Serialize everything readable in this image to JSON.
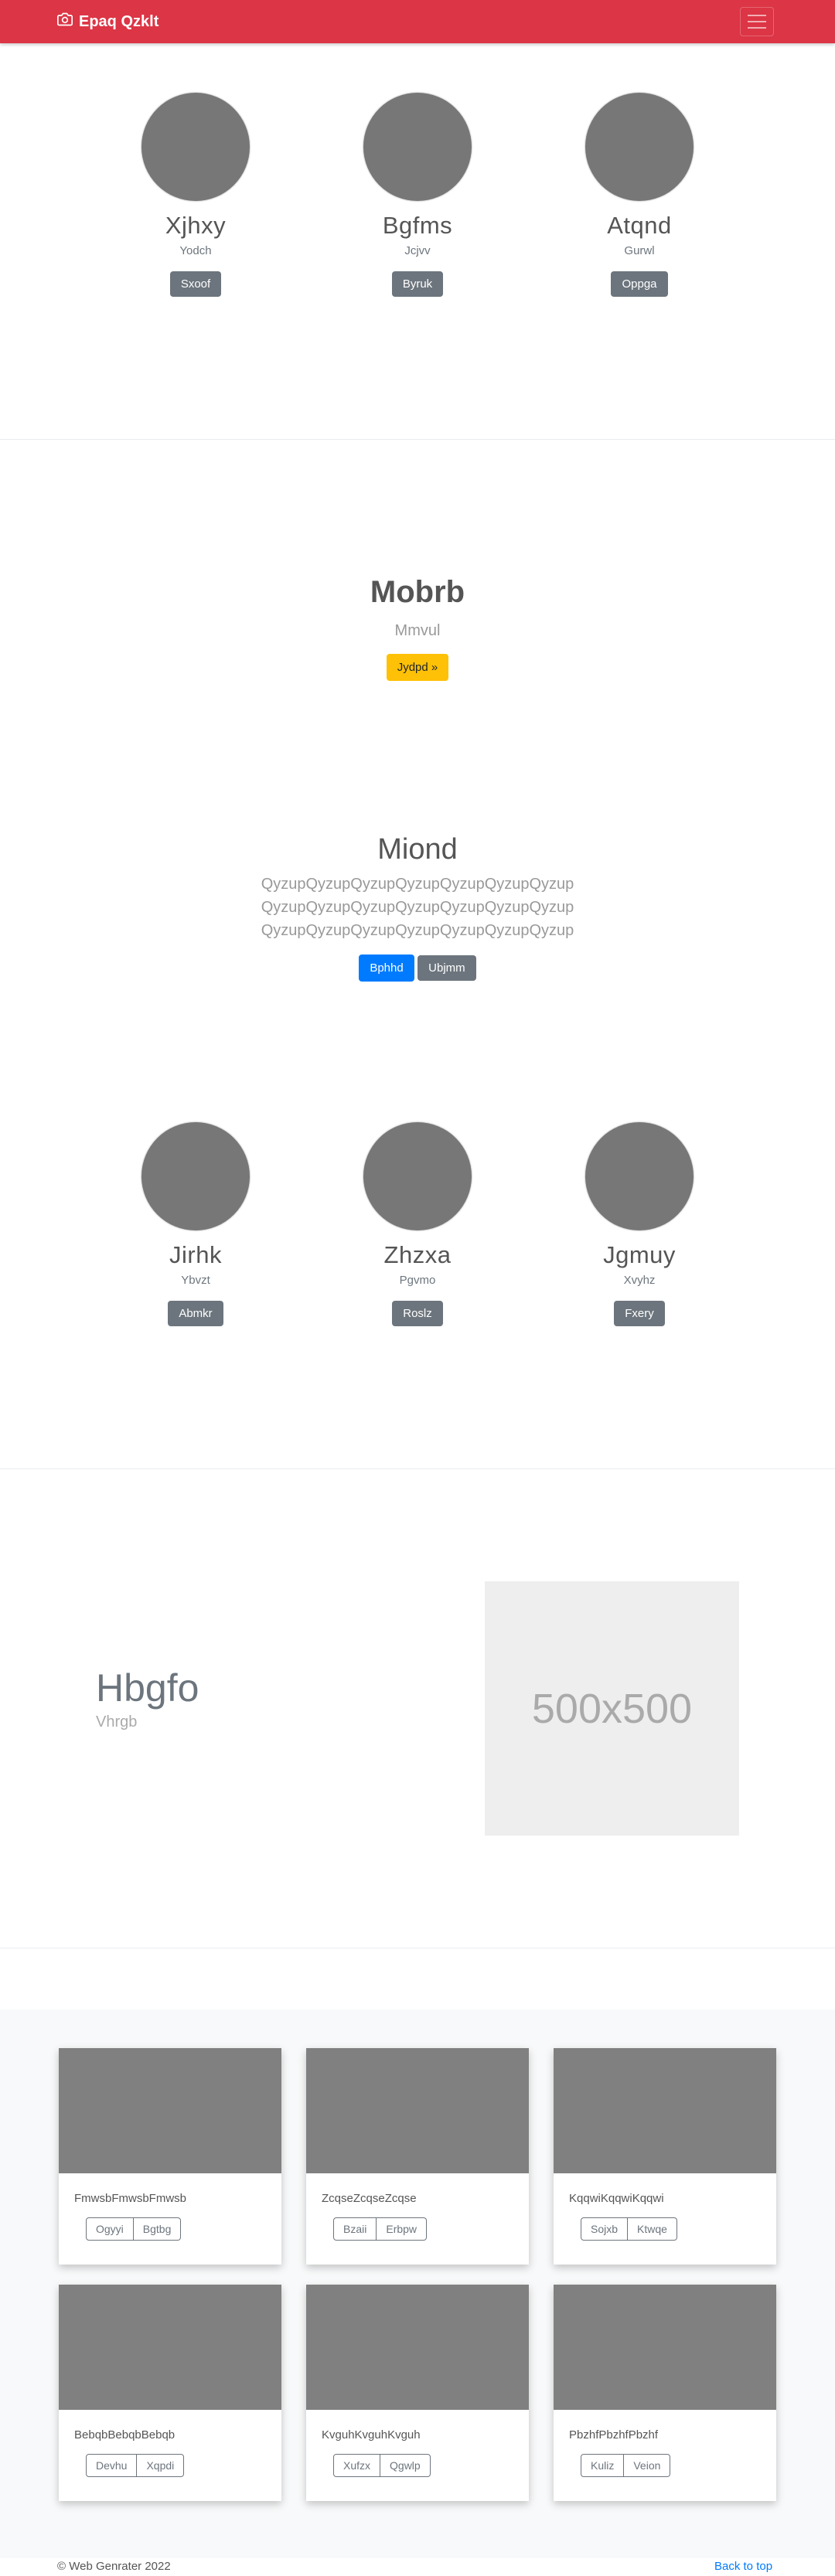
{
  "navbar": {
    "brand": "Epaq Qzklt",
    "brand_icon": "camera-icon",
    "toggler_icon": "hamburger-icon"
  },
  "top_people": [
    {
      "name": "Xjhxy",
      "sub": "Yodch",
      "button": "Sxoof"
    },
    {
      "name": "Bgfms",
      "sub": "Jcjvv",
      "button": "Byruk"
    },
    {
      "name": "Atqnd",
      "sub": "Gurwl",
      "button": "Oppga"
    }
  ],
  "hero": {
    "title": "Mobrb",
    "subtitle": "Mmvul",
    "button": "Jydpd »"
  },
  "jumbo": {
    "title": "Miond",
    "lines": [
      "QyzupQyzupQyzupQyzupQyzupQyzupQyzup",
      "QyzupQyzupQyzupQyzupQyzupQyzupQyzup",
      "QyzupQyzupQyzupQyzupQyzupQyzupQyzup"
    ],
    "primary_button": "Bphhd",
    "secondary_button": "Ubjmm"
  },
  "mid_people": [
    {
      "name": "Jirhk",
      "sub": "Ybvzt",
      "button": "Abmkr"
    },
    {
      "name": "Zhzxa",
      "sub": "Pgvmo",
      "button": "Roslz"
    },
    {
      "name": "Jgmuy",
      "sub": "Xvyhz",
      "button": "Fxery"
    }
  ],
  "feature": {
    "title": "Hbgfo",
    "subtitle": "Vhrgb",
    "placeholder": "500x500"
  },
  "cards": [
    {
      "text": "FmwsbFmwsbFmwsb",
      "btn1": "Ogyyi",
      "btn2": "Bgtbg"
    },
    {
      "text": "ZcqseZcqseZcqse",
      "btn1": "Bzaii",
      "btn2": "Erbpw"
    },
    {
      "text": "KqqwiKqqwiKqqwi",
      "btn1": "Sojxb",
      "btn2": "Ktwqe"
    },
    {
      "text": "BebqbBebqbBebqb",
      "btn1": "Devhu",
      "btn2": "Xqpdi"
    },
    {
      "text": "KvguhKvguhKvguh",
      "btn1": "Xufzx",
      "btn2": "Qgwlp"
    },
    {
      "text": "PbzhfPbzhfPbzhf",
      "btn1": "Kuliz",
      "btn2": "Veion"
    }
  ],
  "footer": {
    "copyright": "© Web Genrater 2022",
    "back_to_top": "Back to top"
  },
  "colors": {
    "navbar": "#dc3545",
    "primary": "#007bff",
    "warning": "#ffc107",
    "secondary": "#6c757d"
  }
}
